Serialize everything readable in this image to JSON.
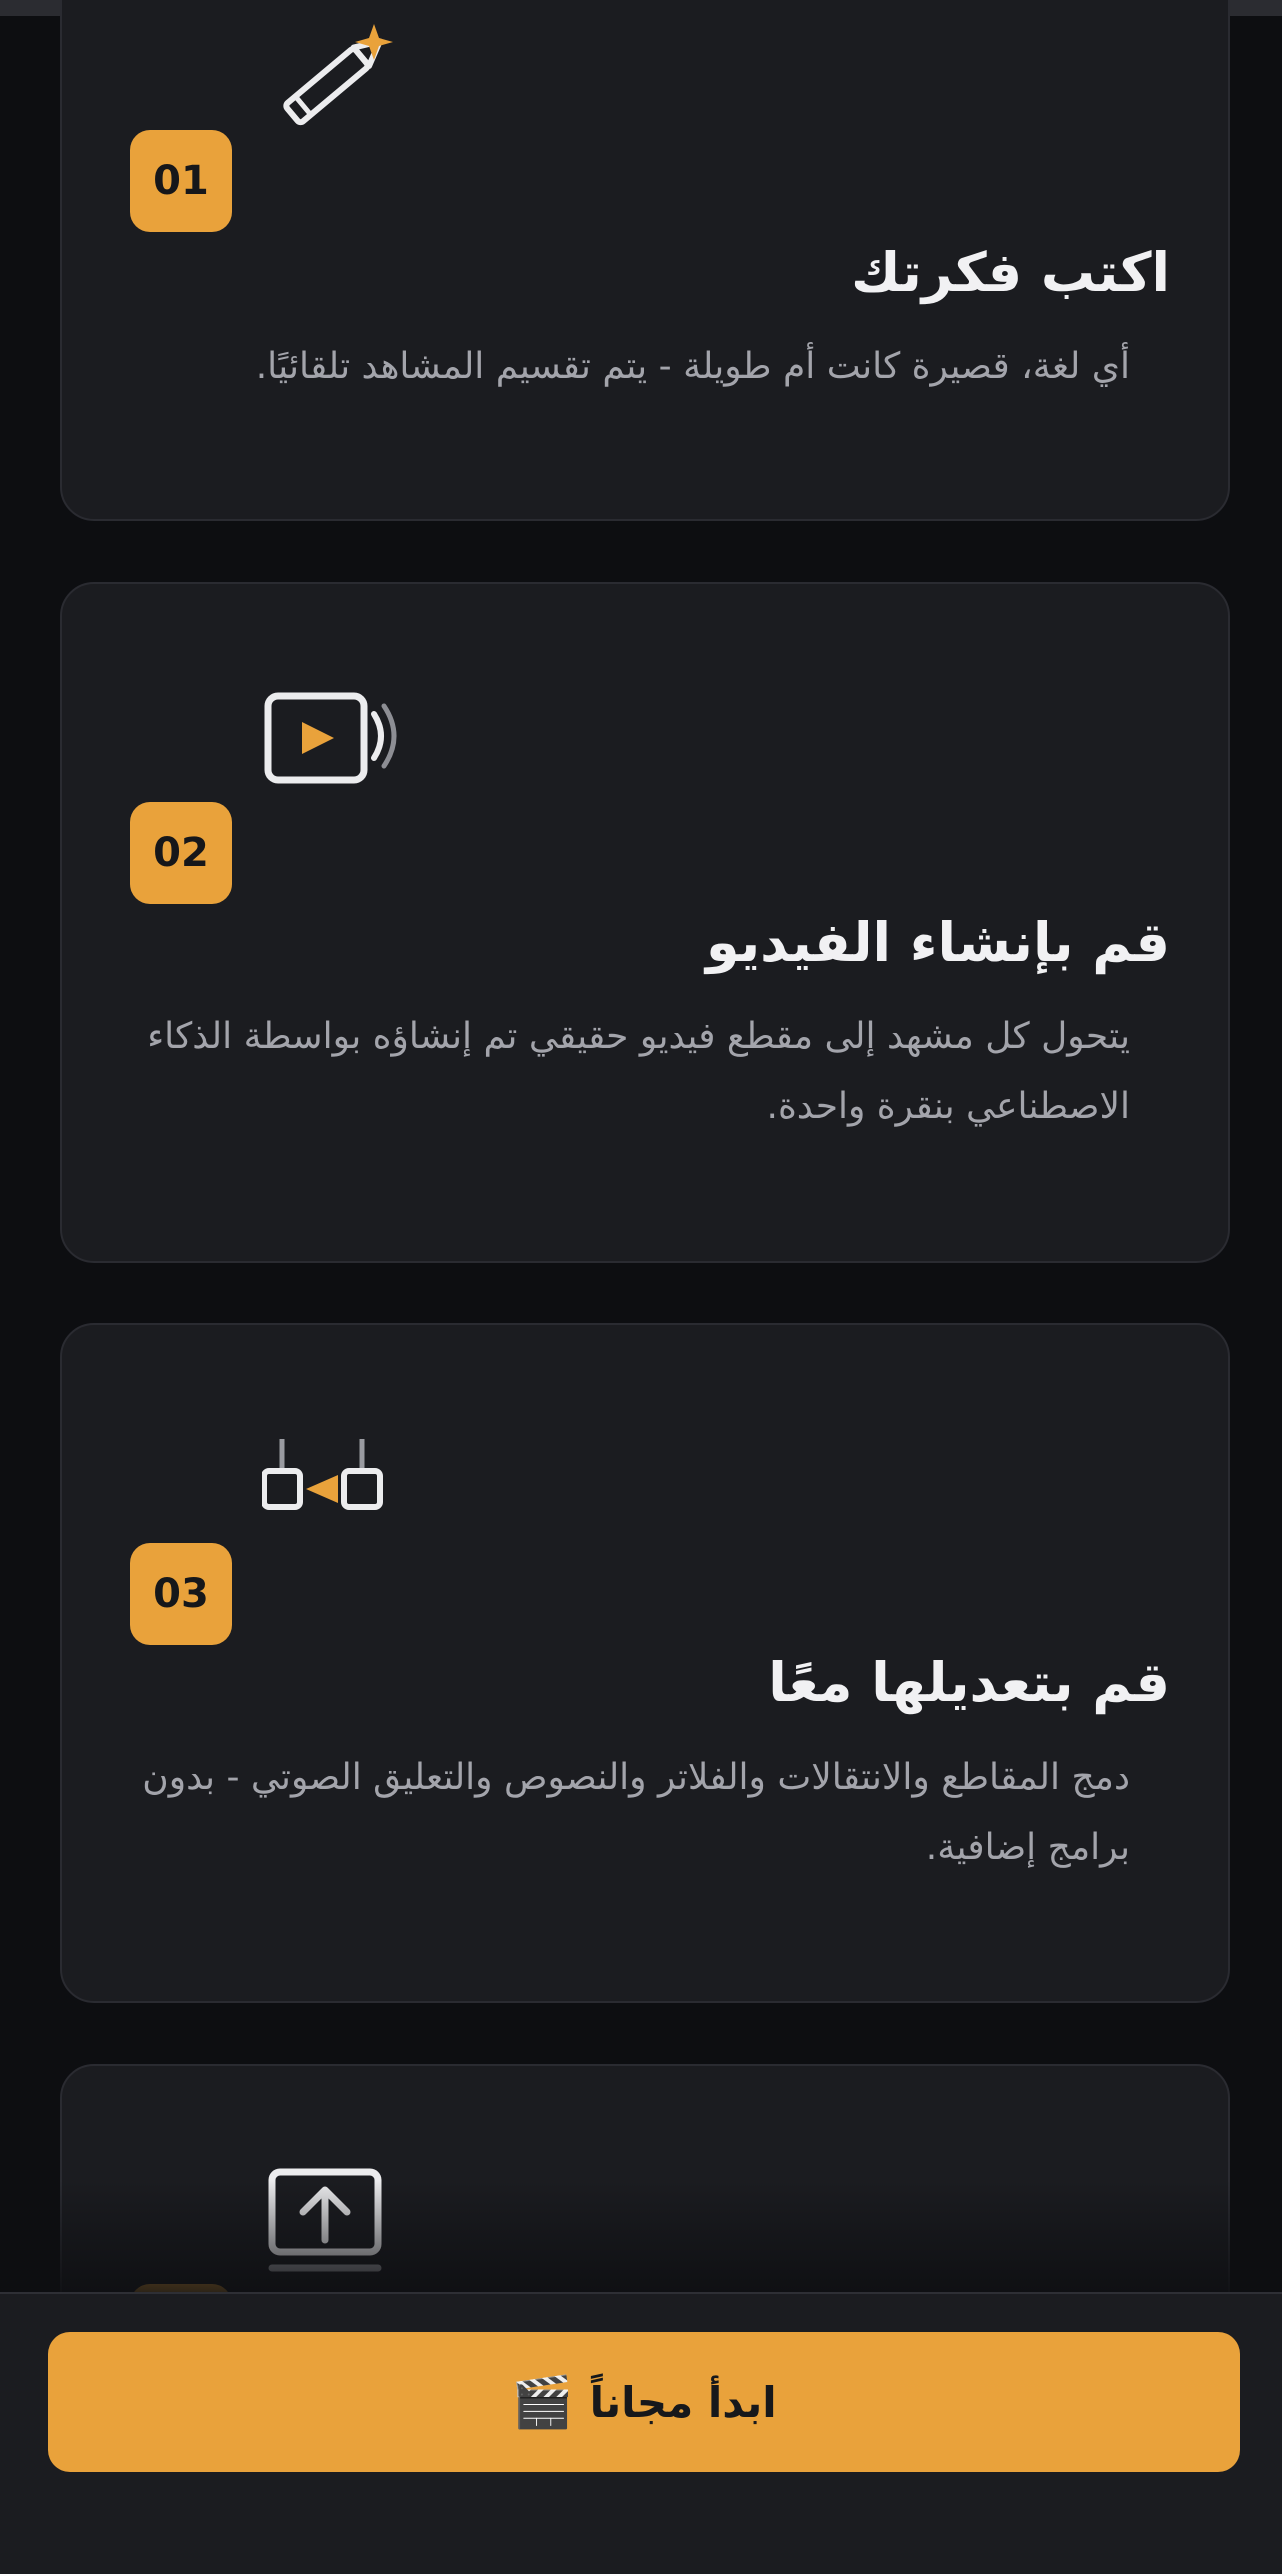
{
  "steps": [
    {
      "number": "01",
      "title": "اكتب فكرتك",
      "description": "أي لغة، قصيرة كانت أم طويلة - يتم تقسيم المشاهد تلقائيًا.",
      "icon": "pencil-sparkle-icon"
    },
    {
      "number": "02",
      "title": "قم بإنشاء الفيديو",
      "description": "يتحول كل مشهد إلى مقطع فيديو حقيقي تم إنشاؤه بواسطة الذكاء الاصطناعي بنقرة واحدة.",
      "icon": "video-play-icon"
    },
    {
      "number": "03",
      "title": "قم بتعديلها معًا",
      "description": "دمج المقاطع والانتقالات والفلاتر والنصوص والتعليق الصوتي - بدون برامج إضافية.",
      "icon": "edit-clips-icon"
    },
    {
      "icon": "upload-icon"
    }
  ],
  "cta": {
    "label": "ابدأ مجاناً",
    "emoji": "🎬"
  },
  "colors": {
    "accent": "#e9a23b",
    "background": "#0d0e11",
    "card": "#1b1c20",
    "title": "#f1f1f3",
    "description": "#a3a4ab"
  }
}
